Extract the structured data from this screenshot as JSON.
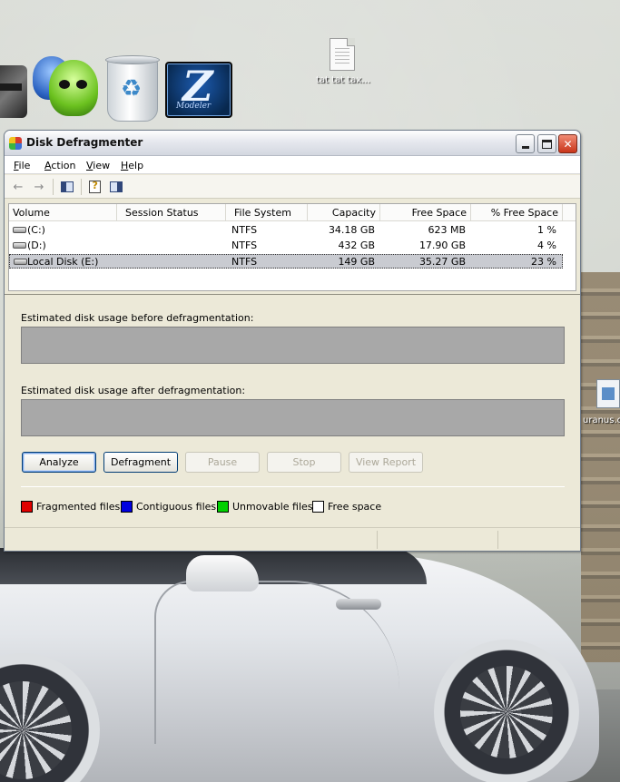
{
  "desktop": {
    "icons": [
      {
        "name": "printer",
        "label": ""
      },
      {
        "name": "messenger",
        "label": ""
      },
      {
        "name": "recycle-bin",
        "label": ""
      },
      {
        "name": "zmodeler",
        "label": "",
        "caption": "Modeler"
      },
      {
        "name": "text-file",
        "label": "tat tat tax..."
      },
      {
        "name": "uranus-file",
        "label": "uranus.c"
      }
    ]
  },
  "window": {
    "title": "Disk Defragmenter",
    "controls": {
      "minimize": "_",
      "maximize": "□",
      "close": "✕"
    },
    "menu": [
      {
        "label": "File",
        "accel": "F",
        "rest": "ile"
      },
      {
        "label": "Action",
        "accel": "A",
        "rest": "ction"
      },
      {
        "label": "View",
        "accel": "V",
        "rest": "iew"
      },
      {
        "label": "Help",
        "accel": "H",
        "rest": "elp"
      }
    ],
    "toolbar": {
      "back_icon": "←",
      "forward_icon": "→"
    },
    "table": {
      "columns": [
        "Volume",
        "Session Status",
        "File System",
        "Capacity",
        "Free Space",
        "% Free Space"
      ],
      "rows": [
        {
          "volume": "(C:)",
          "status": "",
          "fs": "NTFS",
          "capacity": "34.18 GB",
          "free": "623 MB",
          "pct": "1 %"
        },
        {
          "volume": "(D:)",
          "status": "",
          "fs": "NTFS",
          "capacity": "432 GB",
          "free": "17.90 GB",
          "pct": "4 %"
        },
        {
          "volume": "Local Disk (E:)",
          "status": "",
          "fs": "NTFS",
          "capacity": "149 GB",
          "free": "35.27 GB",
          "pct": "23 %"
        }
      ],
      "selected_row": 2
    },
    "before_label": "Estimated disk usage before defragmentation:",
    "after_label": "Estimated disk usage after defragmentation:",
    "buttons": {
      "analyze": "Analyze",
      "defragment": "Defragment",
      "pause": "Pause",
      "stop": "Stop",
      "view_report": "View Report"
    },
    "legend": [
      {
        "label": "Fragmented files",
        "color": "#e00000"
      },
      {
        "label": "Contiguous files",
        "color": "#0000e0"
      },
      {
        "label": "Unmovable files",
        "color": "#00d000"
      },
      {
        "label": "Free space",
        "color": "#ffffff"
      }
    ]
  }
}
